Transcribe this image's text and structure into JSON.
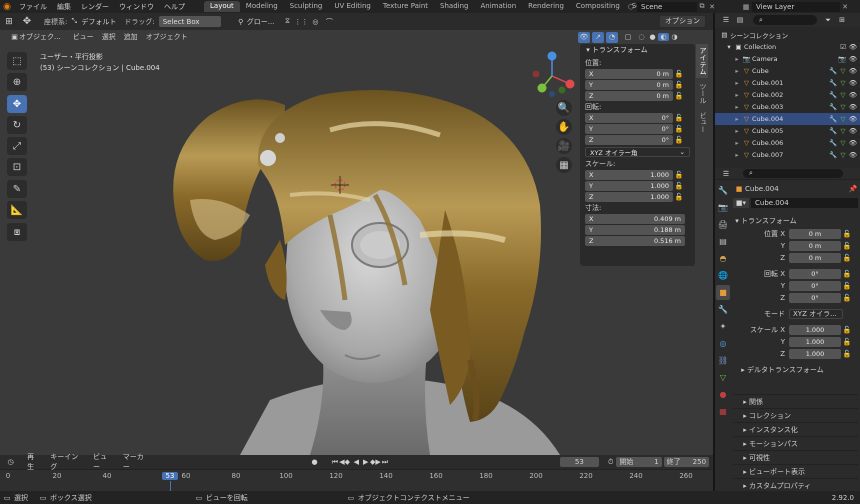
{
  "menu": [
    "ファイル",
    "編集",
    "レンダー",
    "ウィンドウ",
    "ヘルプ"
  ],
  "workspaces": [
    "Layout",
    "Modeling",
    "Sculpting",
    "UV Editing",
    "Texture Paint",
    "Shading",
    "Animation",
    "Rendering",
    "Compositing",
    "Scripting"
  ],
  "active_workspace": "Layout",
  "scene": "Scene",
  "view_layer": "View Layer",
  "header": {
    "coord_label": "座標系:",
    "orientation": "デフォルト",
    "drag_label": "ドラッグ:",
    "drag_value": "Select Box",
    "pivot": "グロー...",
    "options": "オプション"
  },
  "viewport_menu": {
    "mode": "オブジェク...",
    "items": [
      "ビュー",
      "選択",
      "追加",
      "オブジェクト"
    ]
  },
  "overlay": {
    "view_name": "ユーザー・平行投影",
    "object_info": "(53) シーンコレクション | Cube.004"
  },
  "npanel": {
    "title": "トランスフォーム",
    "location_label": "位置:",
    "location": [
      {
        "axis": "X",
        "value": "0 m"
      },
      {
        "axis": "Y",
        "value": "0 m"
      },
      {
        "axis": "Z",
        "value": "0 m"
      }
    ],
    "rotation_label": "回転:",
    "rotation": [
      {
        "axis": "X",
        "value": "0°"
      },
      {
        "axis": "Y",
        "value": "0°"
      },
      {
        "axis": "Z",
        "value": "0°"
      }
    ],
    "rotation_mode": "XYZ オイラー角",
    "scale_label": "スケール:",
    "scale": [
      {
        "axis": "X",
        "value": "1.000"
      },
      {
        "axis": "Y",
        "value": "1.000"
      },
      {
        "axis": "Z",
        "value": "1.000"
      }
    ],
    "dimensions_label": "寸法:",
    "dimensions": [
      {
        "axis": "X",
        "value": "0.409 m"
      },
      {
        "axis": "Y",
        "value": "0.188 m"
      },
      {
        "axis": "Z",
        "value": "0.516 m"
      }
    ],
    "tabs": [
      "アイテム",
      "ツール",
      "ビュー"
    ]
  },
  "outliner": {
    "root": "シーンコレクション",
    "collection": "Collection",
    "items": [
      "Camera",
      "Cube",
      "Cube.001",
      "Cube.002",
      "Cube.003",
      "Cube.004",
      "Cube.005",
      "Cube.006",
      "Cube.007"
    ],
    "selected": "Cube.004"
  },
  "properties": {
    "object_name": "Cube.004",
    "data_name": "Cube.004",
    "transform_title": "トランスフォーム",
    "loc_label": "位置 X",
    "loc": [
      "0 m",
      "0 m",
      "0 m"
    ],
    "rot_label": "回転 X",
    "rot": [
      "0°",
      "0°",
      "0°"
    ],
    "mode_label": "モード",
    "mode_value": "XYZ オイラ...",
    "scale_label": "スケール X",
    "scale": [
      "1.000",
      "1.000",
      "1.000"
    ],
    "delta": "デルタトランスフォーム",
    "sections": [
      "関係",
      "コレクション",
      "インスタンス化",
      "モーションパス",
      "可視性",
      "ビューポート表示",
      "カスタムプロパティ"
    ]
  },
  "timeline": {
    "playback": "再生",
    "keying": "キーイング",
    "view": "ビュー",
    "marker": "マーカー",
    "current_frame": "53",
    "start_label": "開始",
    "start": "1",
    "end_label": "終了",
    "end": "250",
    "ticks": [
      "0",
      "20",
      "40",
      "53",
      "60",
      "80",
      "100",
      "120",
      "140",
      "160",
      "180",
      "200",
      "220",
      "240",
      "260"
    ]
  },
  "status": {
    "select": "選択",
    "box_select": "ボックス選択",
    "rotate_view": "ビューを回転",
    "context_menu": "オブジェクトコンテクストメニュー",
    "version": "2.92.0"
  }
}
